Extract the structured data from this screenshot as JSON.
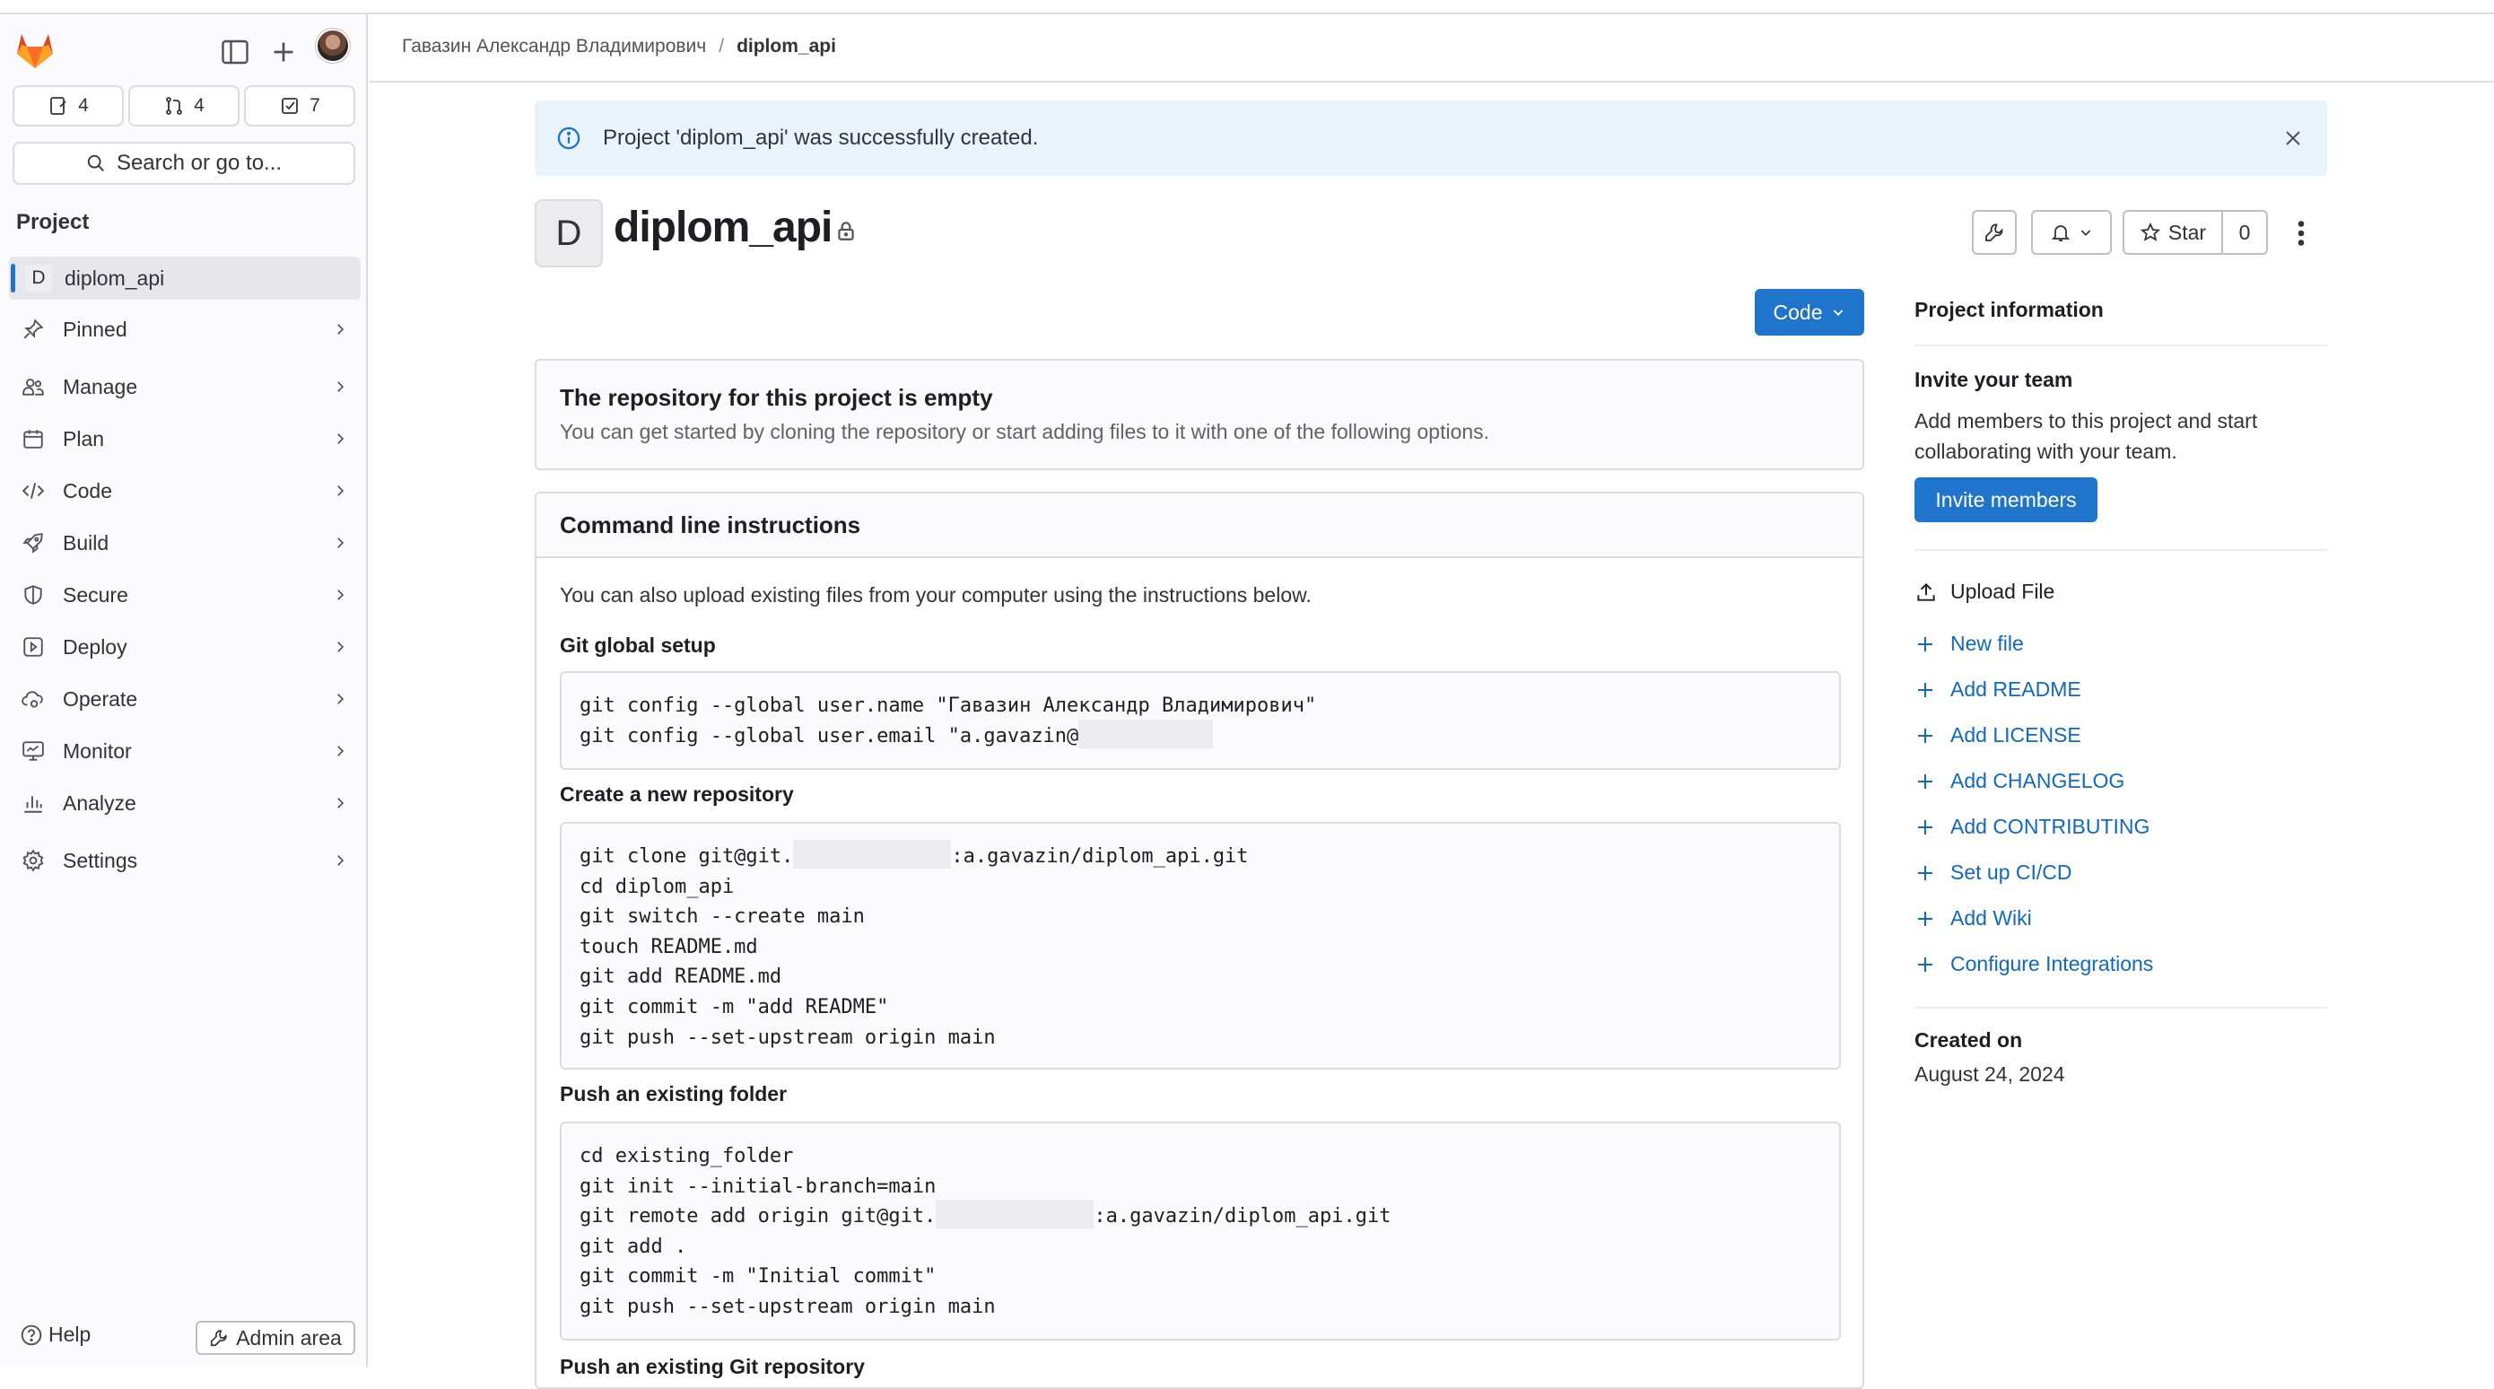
{
  "breadcrumb": {
    "owner": "Гавазин Александр Владимирович",
    "separator": "/",
    "project": "diplom_api"
  },
  "sidebar": {
    "counters": {
      "issues": "4",
      "merge_requests": "4",
      "todos": "7"
    },
    "search_label": "Search or go to...",
    "section_title": "Project",
    "project_badge": "D",
    "project_name": "diplom_api",
    "items": [
      {
        "label": "Pinned",
        "icon": "pin-icon"
      },
      {
        "label": "Manage",
        "icon": "users-icon"
      },
      {
        "label": "Plan",
        "icon": "calendar-icon"
      },
      {
        "label": "Code",
        "icon": "code-icon"
      },
      {
        "label": "Build",
        "icon": "rocket-icon"
      },
      {
        "label": "Secure",
        "icon": "shield-icon"
      },
      {
        "label": "Deploy",
        "icon": "deployments-icon"
      },
      {
        "label": "Operate",
        "icon": "cloud-gear-icon"
      },
      {
        "label": "Monitor",
        "icon": "monitor-icon"
      },
      {
        "label": "Analyze",
        "icon": "chart-icon"
      },
      {
        "label": "Settings",
        "icon": "settings-icon"
      }
    ],
    "help_label": "Help",
    "admin_label": "Admin area"
  },
  "alert": {
    "message": "Project 'diplom_api' was successfully created."
  },
  "project": {
    "badge": "D",
    "title": "diplom_api",
    "star_label": "Star",
    "star_count": "0",
    "code_button": "Code"
  },
  "empty_repo": {
    "title": "The repository for this project is empty",
    "subtitle": "You can get started by cloning the repository or start adding files to it with one of the following options."
  },
  "cli": {
    "title": "Command line instructions",
    "intro": "You can also upload existing files from your computer using the instructions below.",
    "git_global_setup": {
      "heading": "Git global setup",
      "line1": "git config --global user.name \"Гавазин Александр Владимирович\"",
      "line2": "git config --global user.email \"a.gavazin@"
    },
    "new_repo": {
      "heading": "Create a new repository",
      "clone_prefix": "git clone git@git.",
      "clone_suffix": ":a.gavazin/diplom_api.git",
      "rest": "cd diplom_api\ngit switch --create main\ntouch README.md\ngit add README.md\ngit commit -m \"add README\"\ngit push --set-upstream origin main"
    },
    "existing_folder": {
      "heading": "Push an existing folder",
      "pre": "cd existing_folder\ngit init --initial-branch=main",
      "remote_prefix": "git remote add origin git@git.",
      "remote_suffix": ":a.gavazin/diplom_api.git",
      "post": "git add .\ngit commit -m \"Initial commit\"\ngit push --set-upstream origin main"
    },
    "existing_repo_heading": "Push an existing Git repository"
  },
  "right": {
    "project_info": "Project information",
    "invite_heading": "Invite your team",
    "invite_text": "Add members to this project and start collaborating with your team.",
    "invite_button": "Invite members",
    "upload_file": "Upload File",
    "links": [
      "New file",
      "Add README",
      "Add LICENSE",
      "Add CHANGELOG",
      "Add CONTRIBUTING",
      "Set up CI/CD",
      "Add Wiki",
      "Configure Integrations"
    ],
    "created_label": "Created on",
    "created_date": "August 24, 2024"
  },
  "colors": {
    "accent": "#1f75cb",
    "link": "#1068bf",
    "alert_bg": "#e9f3fc"
  }
}
